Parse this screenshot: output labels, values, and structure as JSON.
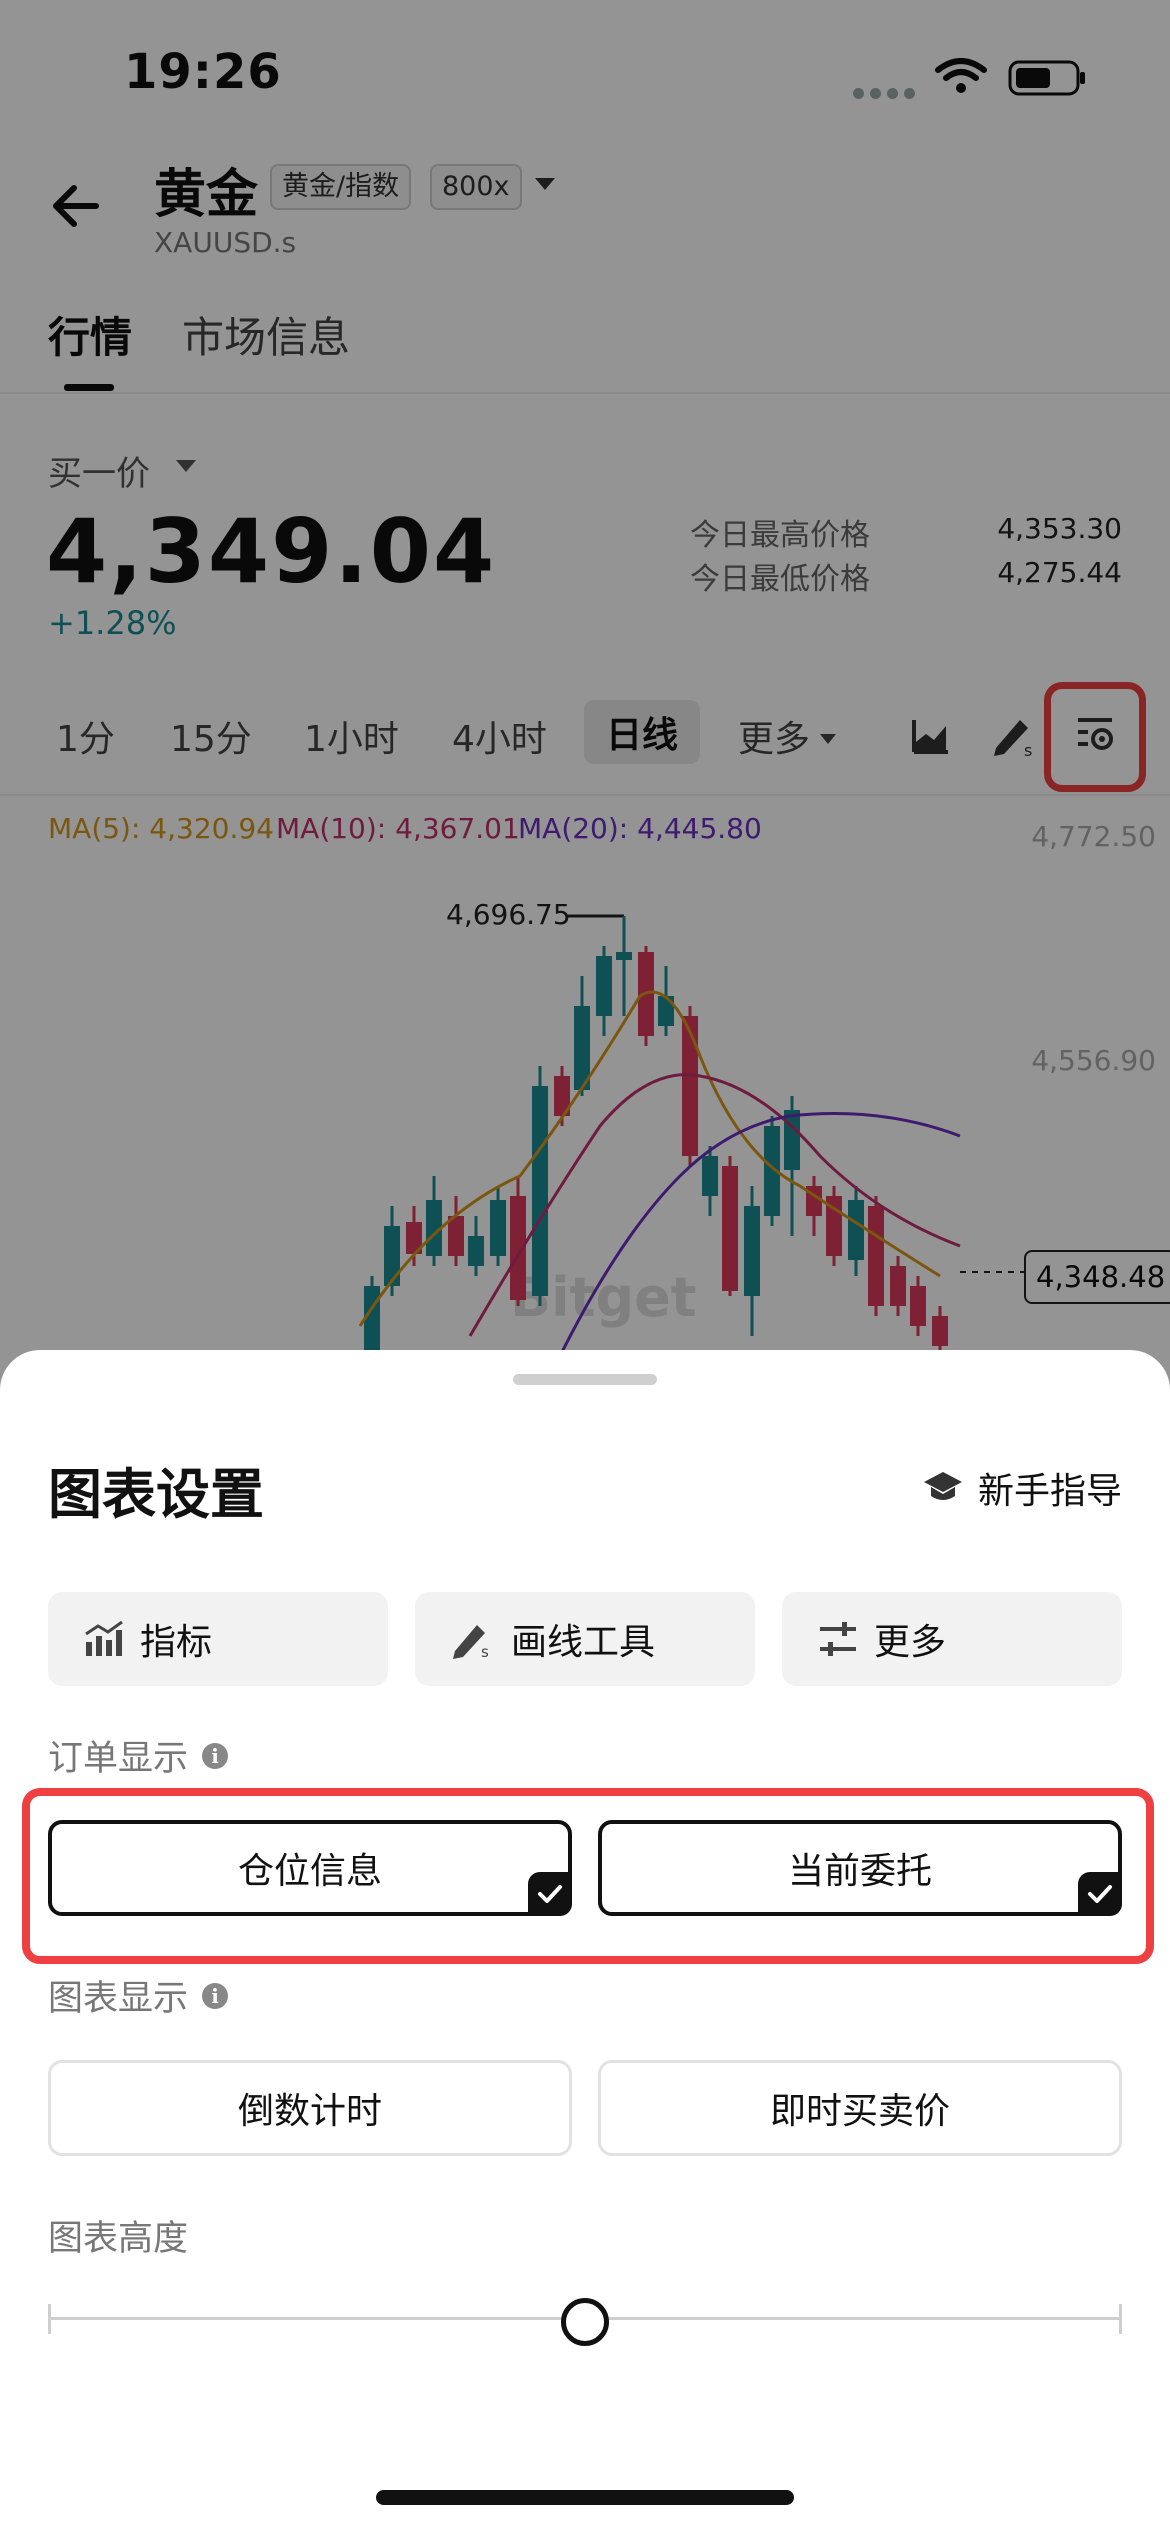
{
  "status_bar": {
    "time": "19:26"
  },
  "header": {
    "title": "黄金",
    "tag_type": "黄金/指数",
    "tag_leverage": "800x",
    "symbol": "XAUUSD.s"
  },
  "main_tabs": [
    {
      "label": "行情",
      "active": true
    },
    {
      "label": "市场信息",
      "active": false
    }
  ],
  "price": {
    "type_label": "买一价",
    "value": "4,349.04",
    "change": "+1.28%",
    "high_label": "今日最高价格",
    "high_value": "4,353.30",
    "low_label": "今日最低价格",
    "low_value": "4,275.44"
  },
  "timeframes": [
    {
      "label": "1分"
    },
    {
      "label": "15分"
    },
    {
      "label": "1小时"
    },
    {
      "label": "4小时"
    },
    {
      "label": "日线",
      "active": true
    },
    {
      "label": "更多"
    }
  ],
  "chart": {
    "ma5": "MA(5): 4,320.94",
    "ma10": "MA(10): 4,367.01",
    "ma20": "MA(20): 4,445.80",
    "axis_top": "4,772.50",
    "axis_mid": "4,556.90",
    "peak": "4,696.75",
    "current_tag": "4,348.48",
    "watermark": "Bitget",
    "colors": {
      "ma5": "#d4941a",
      "ma10": "#c0306e",
      "ma20": "#6b2fc0",
      "up": "#1a8a93",
      "down": "#d93a5a"
    }
  },
  "sheet": {
    "title": "图表设置",
    "guide": "新手指导",
    "tools": [
      {
        "label": "指标",
        "icon": "indicator-icon"
      },
      {
        "label": "画线工具",
        "icon": "draw-line-icon"
      },
      {
        "label": "更多",
        "icon": "sliders-icon"
      }
    ],
    "order_section": "订单显示",
    "order_options": [
      {
        "label": "仓位信息",
        "checked": true
      },
      {
        "label": "当前委托",
        "checked": true
      }
    ],
    "chart_section": "图表显示",
    "chart_options": [
      {
        "label": "倒数计时",
        "checked": false
      },
      {
        "label": "即时买卖价",
        "checked": false
      }
    ],
    "height_section": "图表高度",
    "height_value": 0.5
  }
}
